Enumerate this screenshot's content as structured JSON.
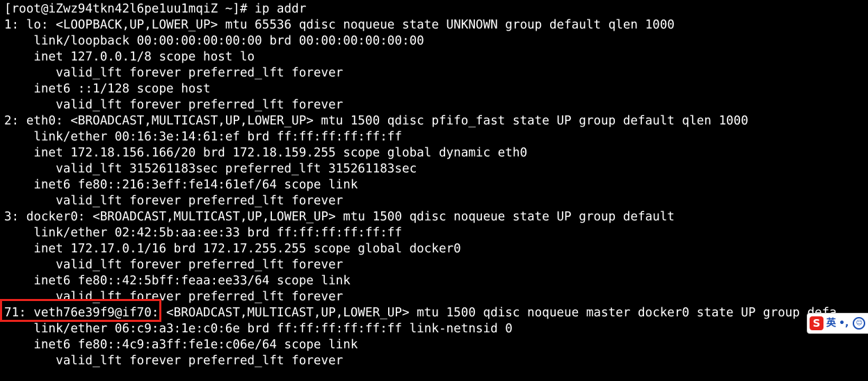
{
  "terminal": {
    "lines": [
      "[root@iZwz94tkn42l6pe1uu1mqiZ ~]# ip addr",
      "1: lo: <LOOPBACK,UP,LOWER_UP> mtu 65536 qdisc noqueue state UNKNOWN group default qlen 1000",
      "    link/loopback 00:00:00:00:00:00 brd 00:00:00:00:00:00",
      "    inet 127.0.0.1/8 scope host lo",
      "       valid_lft forever preferred_lft forever",
      "    inet6 ::1/128 scope host",
      "       valid_lft forever preferred_lft forever",
      "2: eth0: <BROADCAST,MULTICAST,UP,LOWER_UP> mtu 1500 qdisc pfifo_fast state UP group default qlen 1000",
      "    link/ether 00:16:3e:14:61:ef brd ff:ff:ff:ff:ff:ff",
      "    inet 172.18.156.166/20 brd 172.18.159.255 scope global dynamic eth0",
      "       valid_lft 315261183sec preferred_lft 315261183sec",
      "    inet6 fe80::216:3eff:fe14:61ef/64 scope link",
      "       valid_lft forever preferred_lft forever",
      "3: docker0: <BROADCAST,MULTICAST,UP,LOWER_UP> mtu 1500 qdisc noqueue state UP group default",
      "    link/ether 02:42:5b:aa:ee:33 brd ff:ff:ff:ff:ff:ff",
      "    inet 172.17.0.1/16 brd 172.17.255.255 scope global docker0",
      "       valid_lft forever preferred_lft forever",
      "    inet6 fe80::42:5bff:feaa:ee33/64 scope link",
      "       valid_lft forever preferred_lft forever",
      "71: veth76e39f9@if70: <BROADCAST,MULTICAST,UP,LOWER_UP> mtu 1500 qdisc noqueue master docker0 state UP group defa",
      "    link/ether 06:c9:a3:1e:c0:6e brd ff:ff:ff:ff:ff:ff link-netnsid 0",
      "    inet6 fe80::4c9:a3ff:fe1e:c06e/64 scope link",
      "       valid_lft forever preferred_lft forever"
    ]
  },
  "ime_toolbar": {
    "logo": "S",
    "mode": "英",
    "punct": "•,",
    "emoji": "☺"
  },
  "colors": {
    "background": "#000000",
    "text": "#ffffff",
    "highlight": "#e8231c"
  }
}
